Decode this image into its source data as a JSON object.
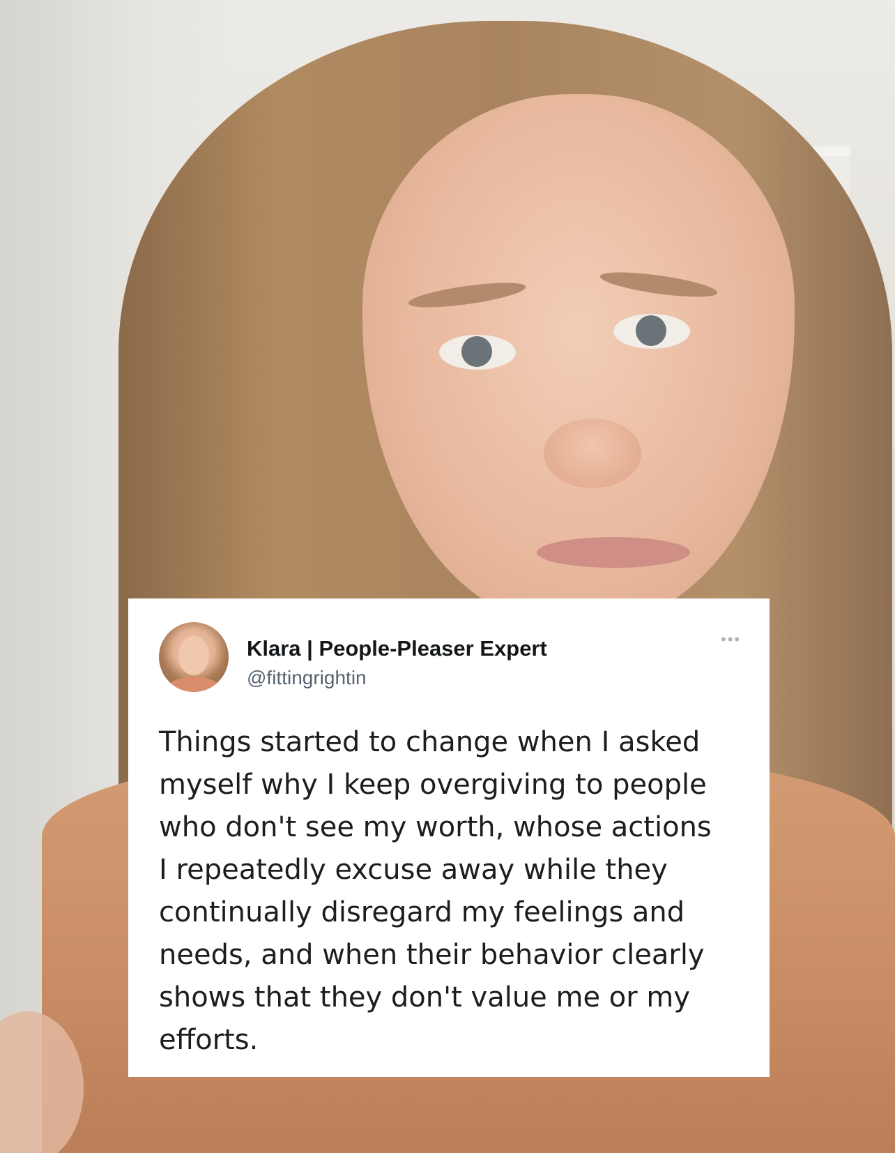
{
  "tweet": {
    "author_name": "Klara | People-Pleaser Expert",
    "author_handle": "@fittingrightin",
    "more_icon": "more-horizontal-icon",
    "body_lines": [
      "Things started to change when I asked",
      "myself why I keep overgiving to people",
      "who don't see my worth, whose actions",
      "I repeatedly excuse away while they",
      "continually disregard my feelings and",
      "needs, and when their behavior clearly",
      "shows that they don't value me or my",
      "efforts."
    ]
  },
  "colors": {
    "card_background": "#ffffff",
    "name_text": "#14171a",
    "handle_text": "#566370",
    "body_text": "#1d1d1f"
  }
}
